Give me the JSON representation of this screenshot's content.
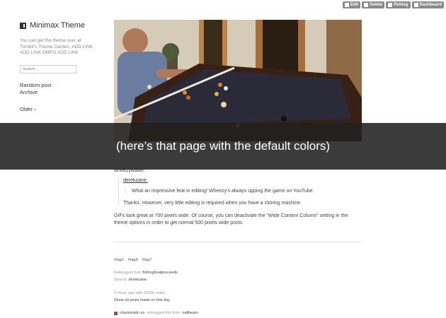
{
  "controls": {
    "edit": "Edit",
    "delete": "Delete",
    "reblog": "Reblog",
    "dashboard": "Dashboard"
  },
  "sidebar": {
    "title": "Minimax Theme",
    "description": "You can get the theme over at Tumblr's Theme Garden. ADD LINK ADD LINK OMFG ADD LINK",
    "search_placeholder": "Search...",
    "links": [
      "Random post",
      "Archive"
    ],
    "older": "Older ›"
  },
  "banner": {
    "text": "(here’s that page with the default colors)"
  },
  "post": {
    "cut_user": "wheezywaiter:",
    "quote_user": "derekzane:",
    "quote_text": "What an impressive feat in editing! Wheezy's always upping the game on YouTube.",
    "reply_text": "Thanks. However, very little editing is required when you have a cloning machine.",
    "body_text": "GIFs look great at 700 pixels wide. Of course, you can deactivate the “Wide Content Column” setting in the theme options in order to get normal 500 pixels wide posts.",
    "tags": [
      "#tag2",
      "#tag8",
      "#tag7"
    ],
    "reblogged_prefix": "Reblogged from",
    "reblogged_from": "fishingboatproceeds",
    "source_prefix": "Source:",
    "source": "derekzane",
    "time_notes": "2 hours ago with 20256 notes",
    "show_all": "Show all posts made on this day",
    "note_user": "charismatic-xo",
    "note_middle": "reblogged this from",
    "note_source": "nailbeam"
  }
}
